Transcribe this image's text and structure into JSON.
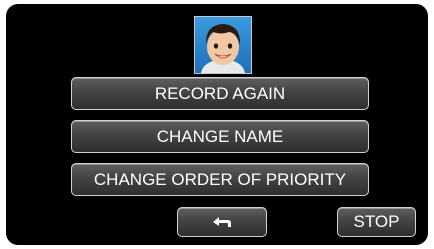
{
  "profile": {
    "icon": "face-thumbnail-icon",
    "colors": {
      "skin": "#f2c8a4",
      "hair": "#2b1a10",
      "background": "#2f8fd8"
    }
  },
  "menu": {
    "items": [
      {
        "label": "RECORD AGAIN"
      },
      {
        "label": "CHANGE NAME"
      },
      {
        "label": "CHANGE ORDER OF PRIORITY"
      }
    ]
  },
  "footer": {
    "back_icon": "return-arrow-icon",
    "stop_label": "STOP"
  },
  "colors": {
    "screen_background": "#000000",
    "button_border": "#d2d2d2",
    "button_text": "#ffffff"
  }
}
